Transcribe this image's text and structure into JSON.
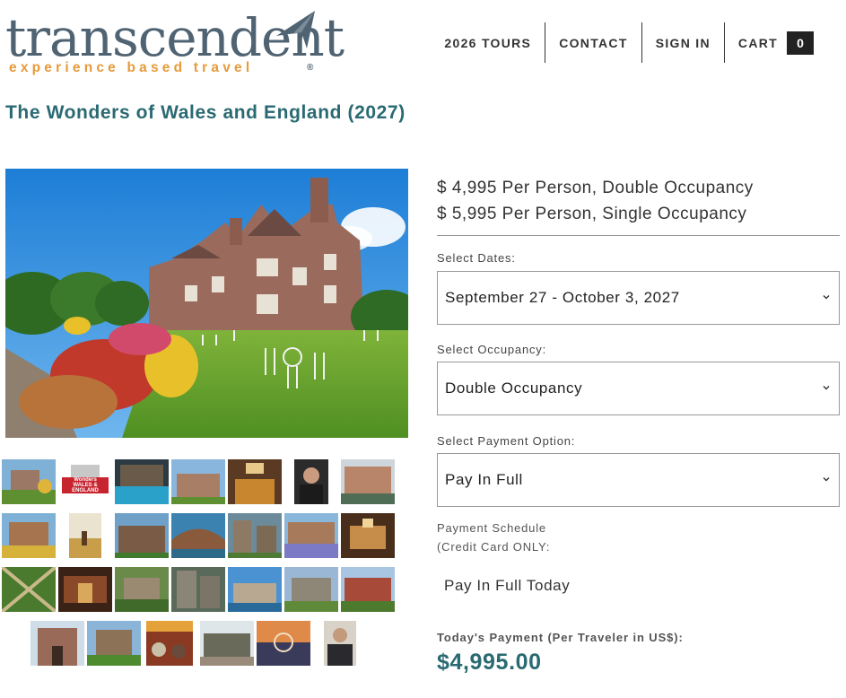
{
  "header": {
    "logo_word": "transcendent",
    "logo_tagline": "experience based travel",
    "logo_reg": "®",
    "nav": {
      "tours": "2026 TOURS",
      "contact": "CONTACT",
      "sign_in": "SIGN IN",
      "cart": "CART",
      "cart_count": "0"
    }
  },
  "product": {
    "title": "The Wonders of Wales and England (2027)",
    "price_double": "$ 4,995 Per Person, Double Occupancy",
    "price_single": "$ 5,995 Per Person, Single Occupancy"
  },
  "form": {
    "dates_label": "Select Dates:",
    "dates_value": "September 27 - October 3, 2027",
    "occupancy_label": "Select Occupancy:",
    "occupancy_value": "Double Occupancy",
    "payment_label": "Select Payment Option:",
    "payment_value": "Pay In Full",
    "schedule_label_1": "Payment Schedule",
    "schedule_label_2": "(Credit Card ONLY:",
    "schedule_value": "Pay In Full Today",
    "today_label": "Today's Payment (Per Traveler in US$):",
    "today_amount": "$4,995.00"
  },
  "thumb_badge": {
    "line1": "Wonders",
    "line2": "WALES &",
    "line3": "ENGLAND"
  },
  "colors": {
    "accent_teal": "#2a6a72",
    "logo_slate": "#4f6372",
    "logo_orange": "#e69a3b",
    "cart_badge": "#222222"
  },
  "icons": [
    "logo-arrow-icon",
    "chevron-down-icon"
  ]
}
